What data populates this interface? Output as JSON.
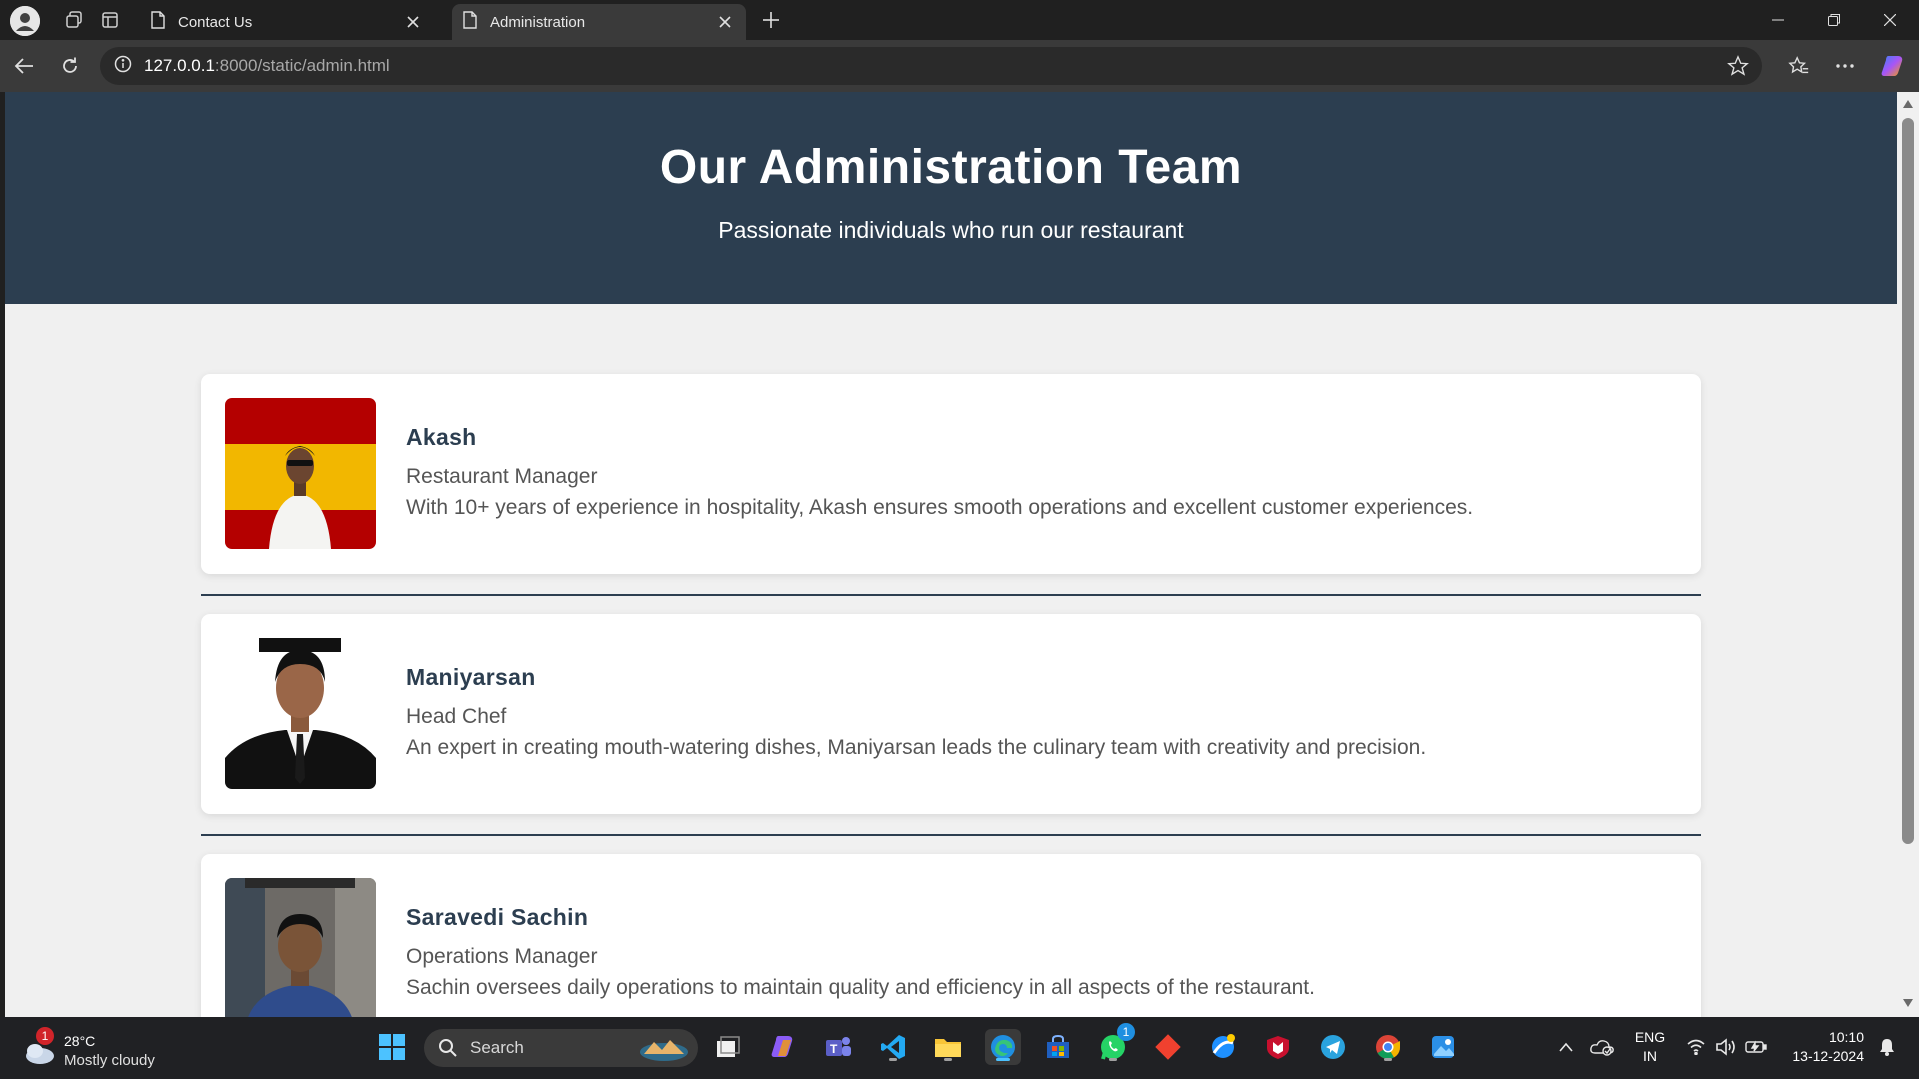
{
  "browser": {
    "tabs": [
      {
        "title": "Contact Us",
        "active": false
      },
      {
        "title": "Administration",
        "active": true
      }
    ],
    "url_host": "127.0.0.1",
    "url_rest": ":8000/static/admin.html"
  },
  "page": {
    "hero_title": "Our Administration Team",
    "hero_subtitle": "Passionate individuals who run our restaurant",
    "members": [
      {
        "name": "Akash",
        "role": "Restaurant Manager",
        "description": "With 10+ years of experience in hospitality, Akash ensures smooth operations and excellent customer experiences."
      },
      {
        "name": "Maniyarsan",
        "role": "Head Chef",
        "description": "An expert in creating mouth-watering dishes, Maniyarsan leads the culinary team with creativity and precision."
      },
      {
        "name": "Saravedi Sachin",
        "role": "Operations Manager",
        "description": "Sachin oversees daily operations to maintain quality and efficiency in all aspects of the restaurant."
      }
    ]
  },
  "taskbar": {
    "weather_temp": "28°C",
    "weather_condition": "Mostly cloudy",
    "weather_badge": "1",
    "search_label": "Search",
    "whatsapp_badge": "1",
    "language_line1": "ENG",
    "language_line2": "IN",
    "time": "10:10",
    "date": "13-12-2024"
  },
  "colors": {
    "hero_bg": "#2c3e50",
    "page_bg": "#f0f0f0",
    "card_bg": "#ffffff"
  }
}
